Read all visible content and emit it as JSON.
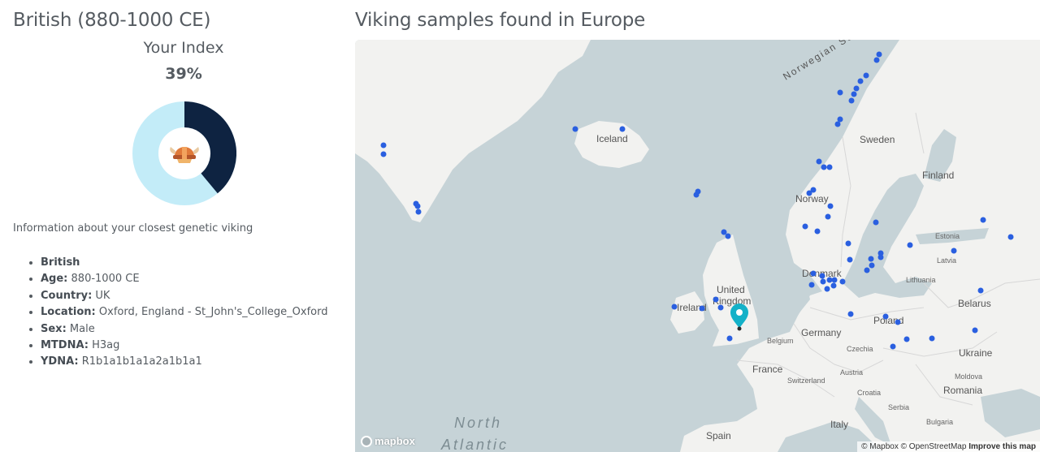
{
  "profile": {
    "title": "British (880-1000 CE)",
    "index_label": "Your Index",
    "index_value": "39%",
    "index_fraction": 0.39,
    "colors": {
      "filled": "#0e2341",
      "remaining": "#c3ecf8",
      "icon": "viking-helmet-icon"
    },
    "info_heading": "Information about your closest genetic viking",
    "name": "British",
    "fields": [
      {
        "label": "Age:",
        "value": "880-1000 CE"
      },
      {
        "label": "Country:",
        "value": "UK"
      },
      {
        "label": "Location:",
        "value": "Oxford, England - St_John's_College_Oxford"
      },
      {
        "label": "Sex:",
        "value": "Male"
      },
      {
        "label": "MTDNA:",
        "value": "H3ag"
      },
      {
        "label": "YDNA:",
        "value": "R1b1a1b1a1a2a1b1a1"
      }
    ]
  },
  "map": {
    "title": "Viking samples found in Europe",
    "marker_color": "#2a5fe0",
    "pin_color": "#14b1c8",
    "labels": {
      "iceland": "Iceland",
      "sweden": "Sweden",
      "finland": "Finland",
      "norway": "Norway",
      "norwegian_sea": "Norwegian Sea",
      "estonia": "Estonia",
      "latvia": "Latvia",
      "lithuania": "Lithuania",
      "belarus": "Belarus",
      "denmark": "Denmark",
      "united_kingdom_1": "United",
      "united_kingdom_2": "Kingdom",
      "ireland": "Ireland",
      "poland": "Poland",
      "germany": "Germany",
      "belgium": "Belgium",
      "czechia": "Czechia",
      "ukraine": "Ukraine",
      "france": "France",
      "switzerland": "Switzerland",
      "austria": "Austria",
      "moldova": "Moldova",
      "croatia": "Croatia",
      "romania": "Romania",
      "serbia": "Serbia",
      "bulgaria": "Bulgaria",
      "italy": "Italy",
      "spain": "Spain",
      "north_atlantic_1": "North",
      "north_atlantic_2": "Atlantic"
    },
    "attribution": {
      "mapbox": "© Mapbox",
      "osm": "© OpenStreetMap",
      "improve": "Improve this map",
      "logo": "mapbox"
    }
  }
}
